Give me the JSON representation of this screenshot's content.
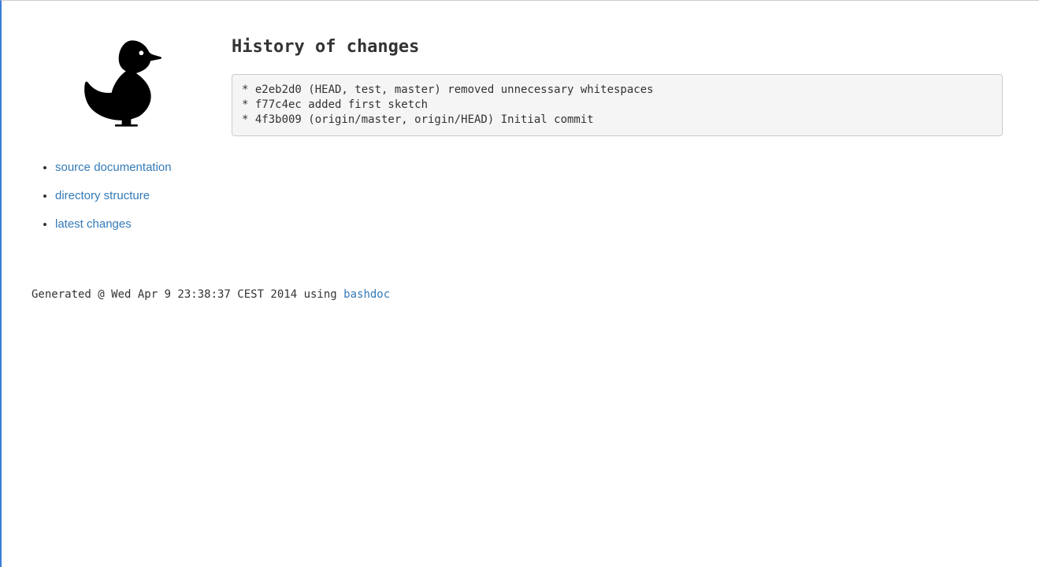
{
  "sidebar": {
    "items": [
      {
        "label": "source documentation"
      },
      {
        "label": "directory structure"
      },
      {
        "label": "latest changes"
      }
    ]
  },
  "main": {
    "title": "History of changes",
    "history_text": "* e2eb2d0 (HEAD, test, master) removed unnecessary whitespaces\n* f77c4ec added first sketch\n* 4f3b009 (origin/master, origin/HEAD) Initial commit"
  },
  "footer": {
    "prefix": "Generated @ Wed Apr 9 23:38:37 CEST 2014 using ",
    "link_label": "bashdoc"
  }
}
